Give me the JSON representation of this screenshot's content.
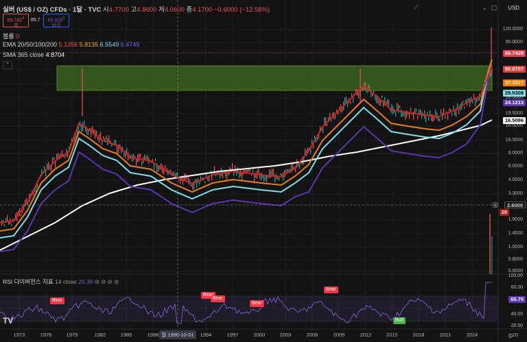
{
  "symbol": {
    "title": "실버 (US$ / OZ) CFDs · 1달 · TVC",
    "o_label": "시",
    "o": "4.7700",
    "h_label": "고",
    "h": "4.8600",
    "l_label": "저",
    "l": "4.0600",
    "c_label": "종",
    "c": "4.1700",
    "change": "−0.6000 (−12.58%)"
  },
  "trade": {
    "sell_price": "69.742",
    "sell_sup": "9",
    "sell_label": "셀",
    "spread": "85.7",
    "buy_price": "69.828",
    "buy_sup": "6",
    "buy_label": "바이"
  },
  "volume": {
    "label": "볼륨",
    "value": "0"
  },
  "ema": {
    "label": "EMA 20/50/100/200",
    "values": [
      "5.1356",
      "5.8135",
      "6.5549",
      "6.4749"
    ],
    "colors": [
      "#ef5350",
      "#ffa726",
      "#80deea",
      "#7b61ff"
    ]
  },
  "sma": {
    "label": "SMA 365 close",
    "value": "4.8704"
  },
  "currency": "USD",
  "y_ticks": [
    "120.0000",
    "90.0000",
    "60.0000",
    "45.0000",
    "35.0000",
    "26.0000",
    "19.5000",
    "14.5000",
    "10.5000",
    "8.0000",
    "6.0000",
    "4.5000",
    "3.3000",
    "2.6000",
    "1.9000",
    "1.4000",
    "1.0000",
    "0.8000",
    "0.6000"
  ],
  "price_tags": [
    {
      "text": "69.7429",
      "bg": "#f23645",
      "fg": "#ffffff"
    },
    {
      "text": "50.8707",
      "bg": "#e53935",
      "fg": "#ffffff"
    },
    {
      "text": "37.3317",
      "bg": "#f57c00",
      "fg": "#ffffff"
    },
    {
      "text": "29.9308",
      "bg": "#80deea",
      "fg": "#000000"
    },
    {
      "text": "24.1213",
      "bg": "#5e35b1",
      "fg": "#ffffff"
    },
    {
      "text": "16.5096",
      "bg": "#ffffff",
      "fg": "#000000"
    },
    {
      "text": "2.6000",
      "bg": "#131313",
      "fg": "#d1d4dc"
    },
    {
      "text": "20",
      "bg": "#b71c1c",
      "fg": "#ffffff"
    },
    {
      "text": "65.75",
      "bg": "#5e35b1",
      "fg": "#ffffff"
    }
  ],
  "rsi": {
    "label": "RSI 다이버전스 지표",
    "setting": "14 close",
    "value": "20.38",
    "ticks": [
      "100.00",
      "60.00",
      "40.00",
      "20.00"
    ]
  },
  "divergence_labels": {
    "bear": "Bear",
    "bull": "Bull"
  },
  "x_ticks": [
    "1973",
    "1976",
    "1979",
    "1982",
    "1985",
    "1988",
    "1994",
    "1997",
    "2000",
    "2003",
    "2006",
    "2009",
    "2012",
    "2015",
    "2018",
    "2021",
    "2024",
    "20"
  ],
  "crosshair_date": "월 1990-10-01",
  "logo": "TV"
}
